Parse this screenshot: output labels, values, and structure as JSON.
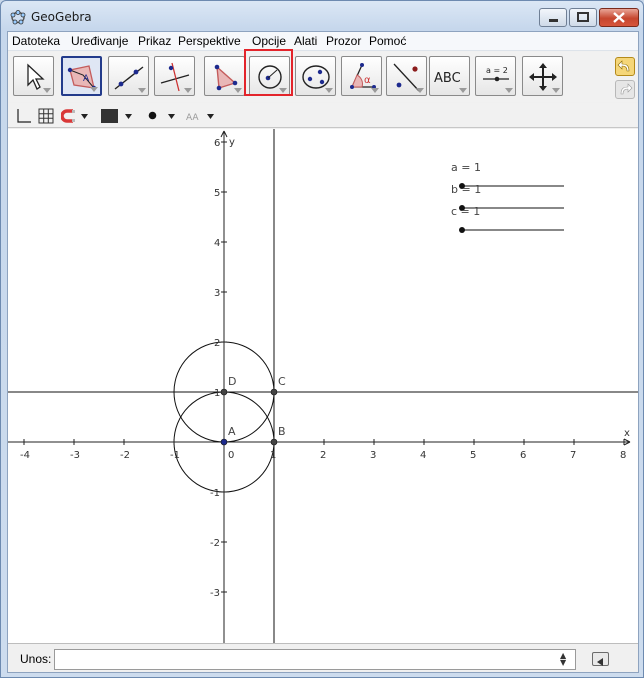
{
  "window": {
    "title": "GeoGebra"
  },
  "menubar": {
    "items": [
      "Datoteka",
      "Uređivanje",
      "Prikaz",
      "Perspektive",
      "Opcije",
      "Alati",
      "Prozor",
      "Pomoć"
    ]
  },
  "toolbar": {
    "tools": [
      {
        "name": "move-tool",
        "icon": "arrow-cursor-icon"
      },
      {
        "name": "polygon-a-tool",
        "icon": "polygon-point-a-icon"
      },
      {
        "name": "line-tool",
        "icon": "line-through-points-icon"
      },
      {
        "name": "perpendicular-line-tool",
        "icon": "perpendicular-line-icon"
      },
      {
        "name": "polygon-tool",
        "icon": "triangle-polygon-icon"
      },
      {
        "name": "circle-tool",
        "icon": "circle-center-point-icon"
      },
      {
        "name": "conic-tool",
        "icon": "ellipse-icon"
      },
      {
        "name": "angle-tool",
        "icon": "angle-alpha-icon"
      },
      {
        "name": "reflect-tool",
        "icon": "reflect-line-icon"
      },
      {
        "name": "text-tool",
        "icon": "text-abc-icon",
        "label": "ABC"
      },
      {
        "name": "slider-tool",
        "icon": "slider-icon",
        "label": "a = 2"
      },
      {
        "name": "move-view-tool",
        "icon": "move-arrows-icon"
      }
    ],
    "more_label": "...",
    "colors": {
      "accent_point": "#1d2a8e",
      "highlight": "#e3242b",
      "angle": "#cc3333"
    }
  },
  "stylebar": {
    "icons": [
      "axes-icon",
      "grid-icon",
      "magnet-icon",
      "color-swatch-icon",
      "point-style-icon",
      "label-style-icon"
    ],
    "label_icon_text": "AA",
    "color": "#333333"
  },
  "sliders": [
    {
      "name": "a",
      "label": "a = 1",
      "value": 1
    },
    {
      "name": "b",
      "label": "b = 1",
      "value": 1
    },
    {
      "name": "c",
      "label": "c = 1",
      "value": 1
    }
  ],
  "graph": {
    "x_axis_label": "x",
    "y_axis_label": "y",
    "x_ticks": [
      "-4",
      "-3",
      "-2",
      "-1",
      "0",
      "1",
      "2",
      "3",
      "4",
      "5",
      "6",
      "7",
      "8"
    ],
    "y_ticks": [
      "6",
      "5",
      "4",
      "3",
      "2",
      "1",
      "-1",
      "-2",
      "-3"
    ],
    "points": [
      {
        "label": "A",
        "x": 0,
        "y": 0,
        "color": "#1d2a8e"
      },
      {
        "label": "B",
        "x": 1,
        "y": 0,
        "color": "#444444"
      },
      {
        "label": "C",
        "x": 1,
        "y": 1,
        "color": "#444444"
      },
      {
        "label": "D",
        "x": 0,
        "y": 1,
        "color": "#444444"
      }
    ],
    "circles": [
      {
        "cx": 0,
        "cy": 0,
        "r": 1
      },
      {
        "cx": 0,
        "cy": 1,
        "r": 1
      }
    ],
    "lines": [
      {
        "type": "vertical",
        "x": 1
      },
      {
        "type": "horizontal",
        "y": 1
      }
    ]
  },
  "inputbar": {
    "label": "Unos:",
    "value": "",
    "keyboard_icon": "keyboard-toggle-icon"
  }
}
